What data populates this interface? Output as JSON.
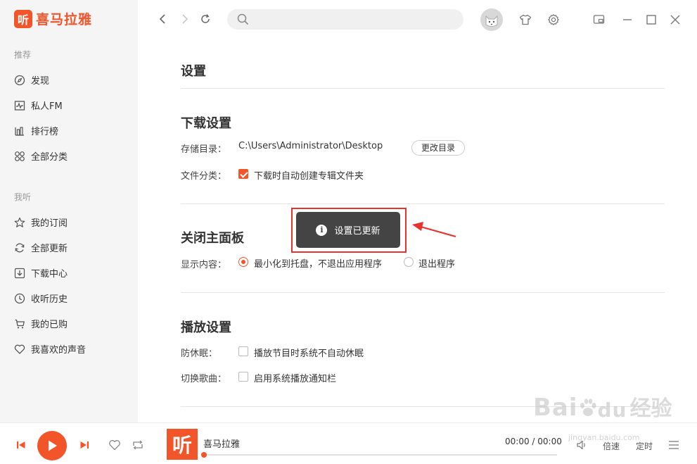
{
  "app": {
    "logo_badge": "听",
    "logo_text": "喜马拉雅",
    "brand_color": "#f3552b"
  },
  "sidebar": {
    "section_recommend": "推荐",
    "section_mine": "我听",
    "items": [
      {
        "label": "发现",
        "icon": "compass-icon"
      },
      {
        "label": "私人FM",
        "icon": "radio-wave-icon"
      },
      {
        "label": "排行榜",
        "icon": "ranking-bars-icon"
      },
      {
        "label": "全部分类",
        "icon": "grid-icon"
      },
      {
        "label": "我的订阅",
        "icon": "star-icon"
      },
      {
        "label": "全部更新",
        "icon": "refresh-icon"
      },
      {
        "label": "下载中心",
        "icon": "download-icon"
      },
      {
        "label": "收听历史",
        "icon": "clock-icon"
      },
      {
        "label": "我的已购",
        "icon": "cart-icon"
      },
      {
        "label": "我喜欢的声音",
        "icon": "heart-icon"
      }
    ]
  },
  "topbar": {
    "search_placeholder": "",
    "search_value": ""
  },
  "settings": {
    "title": "设置",
    "download": {
      "title": "下载设置",
      "storage_label": "存储目录：",
      "storage_path": "C:\\Users\\Administrator\\Desktop",
      "change_button": "更改目录",
      "classify_label": "文件分类：",
      "auto_folder_option": "下载时自动创建专辑文件夹",
      "auto_folder_checked": true
    },
    "close_panel": {
      "title": "关闭主面板",
      "display_label": "显示内容：",
      "options": [
        "最小化到托盘，不退出应用程序",
        "退出程序"
      ],
      "selected_index": 0
    },
    "playback": {
      "title": "播放设置",
      "sleep_label": "防休眠：",
      "sleep_option": "播放节目时系统不自动休眠",
      "sleep_checked": false,
      "switch_label": "切换歌曲：",
      "switch_option": "启用系统播放通知栏",
      "switch_checked": false
    }
  },
  "toast": {
    "message": "设置已更新",
    "icon": "info-icon"
  },
  "player": {
    "cover_text": "听",
    "track_title": "喜马拉雅",
    "time": "00:00 / 00:00",
    "progress": 0,
    "speed_label": "倍速",
    "timer_label": "定时"
  },
  "watermark": {
    "main": "Bai",
    "paw": "du",
    "cn": "经验",
    "sub": "jingyan.baidu.com"
  }
}
